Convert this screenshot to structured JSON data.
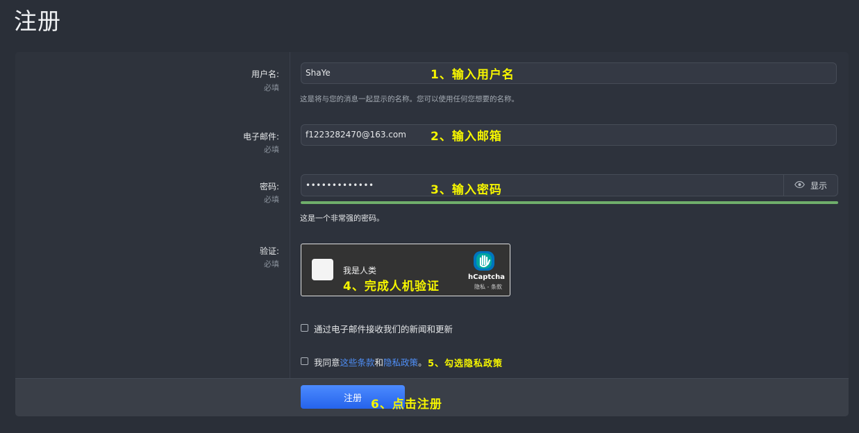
{
  "page": {
    "title": "注册"
  },
  "form": {
    "username": {
      "label": "用户名:",
      "required": "必填",
      "value": "ShaYe",
      "hint": "这是将与您的消息一起显示的名称。您可以使用任何您想要的名称。"
    },
    "email": {
      "label": "电子邮件:",
      "required": "必填",
      "value": "f1223282470@163.com"
    },
    "password": {
      "label": "密码:",
      "required": "必填",
      "value": "•••••••••••••",
      "show_label": "显示",
      "show_icon": "eye-icon",
      "strength_text": "这是一个非常强的密码。",
      "strength_level": 1.0,
      "strength_color": "#6fae6b"
    },
    "captcha": {
      "label": "验证:",
      "required": "必填",
      "checkbox_label": "我是人类",
      "brand": "hCaptcha",
      "links": "隐私 - 条款"
    },
    "newsletter": {
      "label": "通过电子邮件接收我们的新闻和更新"
    },
    "agree": {
      "prefix": "我同意",
      "terms_link": "这些条款",
      "middle": "和",
      "privacy_link": "隐私政策",
      "suffix": "。"
    },
    "submit_label": "注册"
  },
  "annotations": {
    "a1": "1、输入用户名",
    "a2": "2、输入邮箱",
    "a3": "3、输入密码",
    "a4": "4、完成人机验证",
    "a5": "5、勾选隐私政策",
    "a6": "6、点击注册"
  },
  "colors": {
    "accent": "#3b7cf5",
    "annotation": "#f5f500",
    "link": "#4f8ff7"
  }
}
